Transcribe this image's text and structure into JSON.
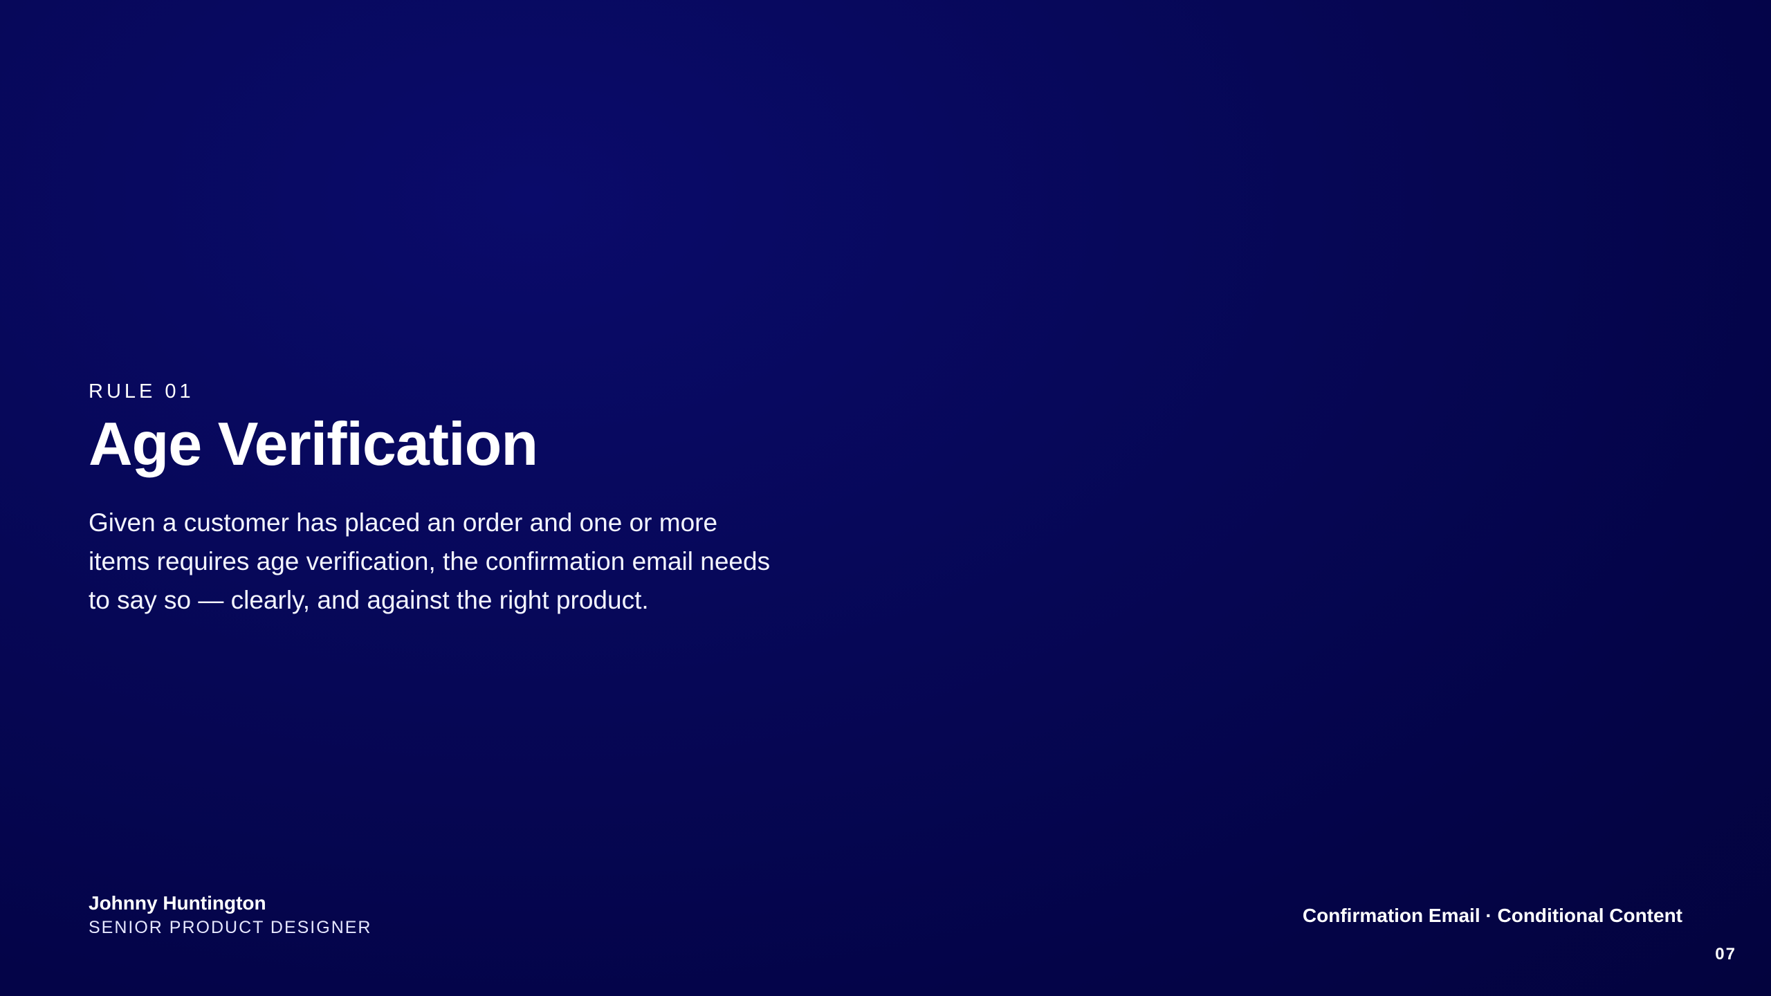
{
  "slide": {
    "eyebrow": "RULE 01",
    "title": "Age Verification",
    "body": "Given a customer has placed an order and one or more items requires age verification, the confirmation email needs to say so — clearly, and against the right product."
  },
  "footer": {
    "author_name": "Johnny Huntington",
    "author_role": "SENIOR PRODUCT DESIGNER",
    "deck_title": "Confirmation Email · Conditional Content",
    "page_number": "07"
  },
  "colors": {
    "background": "#07085a",
    "text": "#ffffff"
  }
}
